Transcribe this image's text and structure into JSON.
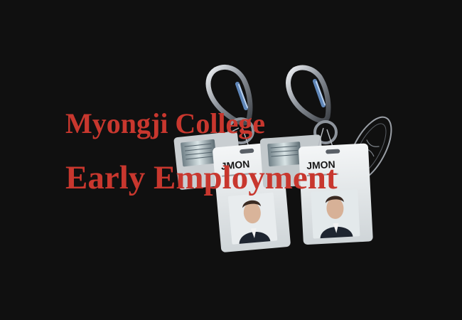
{
  "heading": {
    "line1": "Myongji College",
    "line2": "Early Employment"
  },
  "badges": [
    {
      "brand": "JMON"
    },
    {
      "brand": "JMON"
    }
  ],
  "colors": {
    "background": "#101010",
    "title_red": "#c8372e",
    "badge_card": "#e6e9ea",
    "carabiner_steel": "#9aa0a8",
    "carabiner_gate_blue": "#5f86b8"
  }
}
